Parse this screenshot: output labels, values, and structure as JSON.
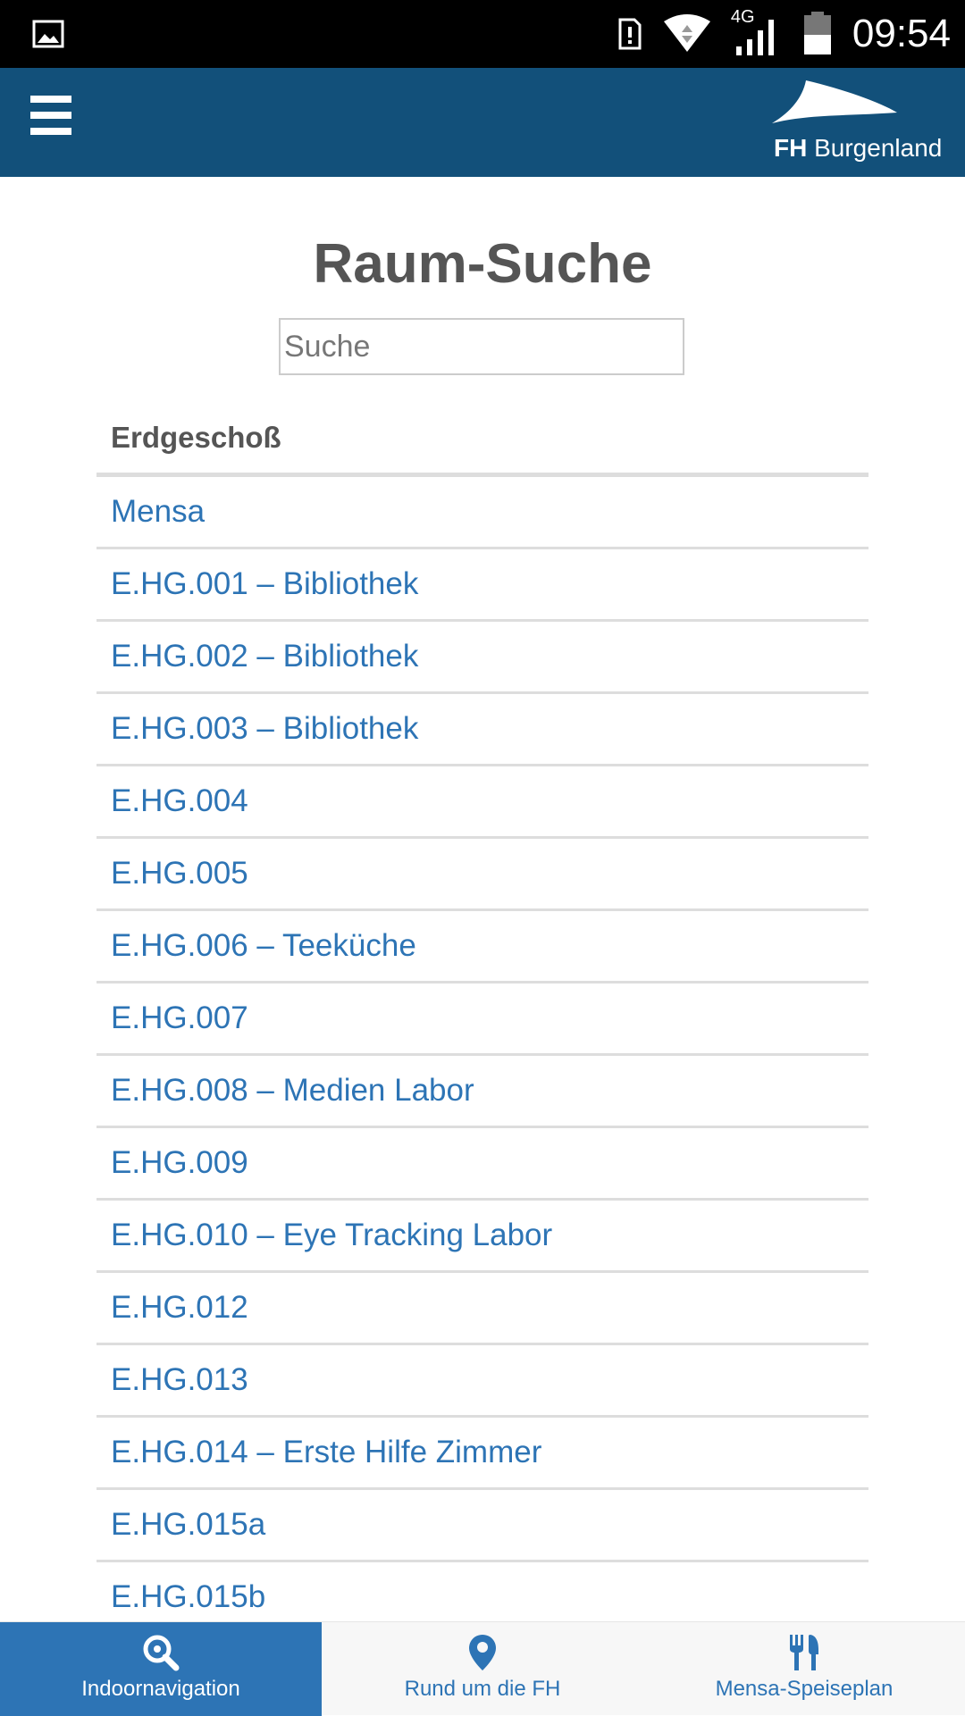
{
  "status_bar": {
    "network_label": "4G",
    "time": "09:54"
  },
  "header": {
    "logo": {
      "bold": "FH",
      "rest": "Burgenland"
    }
  },
  "page": {
    "title": "Raum-Suche",
    "search": {
      "placeholder": "Suche",
      "value": ""
    }
  },
  "section": {
    "heading": "Erdgeschoß",
    "rooms": [
      "Mensa",
      "E.HG.001 – Bibliothek",
      "E.HG.002 – Bibliothek",
      "E.HG.003 – Bibliothek",
      "E.HG.004",
      "E.HG.005",
      "E.HG.006 – Teeküche",
      "E.HG.007",
      "E.HG.008 – Medien Labor",
      "E.HG.009",
      "E.HG.010 – Eye Tracking Labor",
      "E.HG.012",
      "E.HG.013",
      "E.HG.014 – Erste Hilfe Zimmer",
      "E.HG.015a",
      "E.HG.015b"
    ]
  },
  "tabbar": {
    "tabs": [
      {
        "label": "Indoornavigation",
        "icon": "search-icon",
        "active": true
      },
      {
        "label": "Rund um die FH",
        "icon": "map-pin-icon",
        "active": false
      },
      {
        "label": "Mensa-Speiseplan",
        "icon": "cutlery-icon",
        "active": false
      }
    ]
  },
  "colors": {
    "header_bg": "#12507a",
    "link": "#2d74b5",
    "active_tab_bg": "#2d74b5"
  }
}
